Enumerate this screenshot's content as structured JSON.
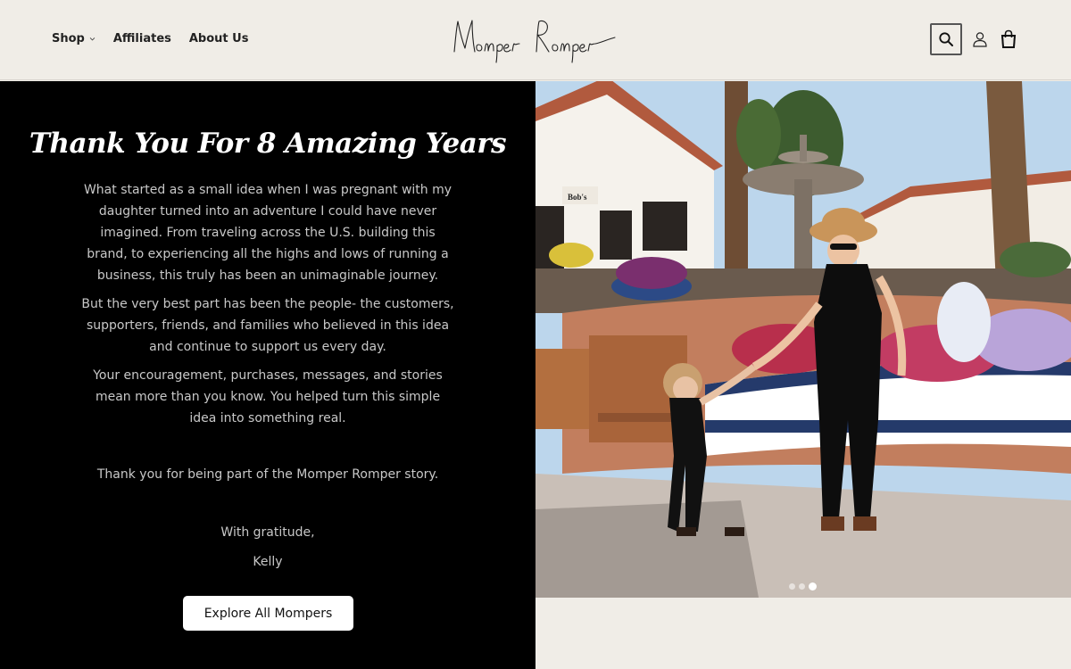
{
  "header": {
    "nav": [
      {
        "label": "Shop",
        "has_dropdown": true
      },
      {
        "label": "Affiliates",
        "has_dropdown": false
      },
      {
        "label": "About Us",
        "has_dropdown": false
      }
    ],
    "logo_text": "Momper Romper",
    "icons": [
      "search-icon",
      "account-icon",
      "cart-icon"
    ]
  },
  "story": {
    "title": "Thank You For 8 Amazing Years",
    "paragraphs": [
      "What started as a small idea when I was pregnant with my daughter turned into an adventure I could have never imagined. From traveling across the U.S. building this brand, to experiencing all the highs and lows of running a business, this truly has been an unimaginable journey.",
      "But the very best part has been the people- the customers, supporters, friends, and families who believed in this idea and continue to support us every day.",
      "Your encouragement, purchases, messages, and stories mean more than you know. You helped turn this simple idea into something real."
    ],
    "thanks": "Thank you for being part of the Momper Romper story.",
    "sign_off": "With gratitude,",
    "name": "Kelly",
    "cta_label": "Explore All Mompers"
  },
  "slideshow": {
    "slide_count": 3,
    "active_index": 2
  },
  "colors": {
    "header_bg": "#f0ede7",
    "panel_bg": "#000000",
    "panel_text": "#c8c8c8",
    "button_bg": "#ffffff"
  }
}
